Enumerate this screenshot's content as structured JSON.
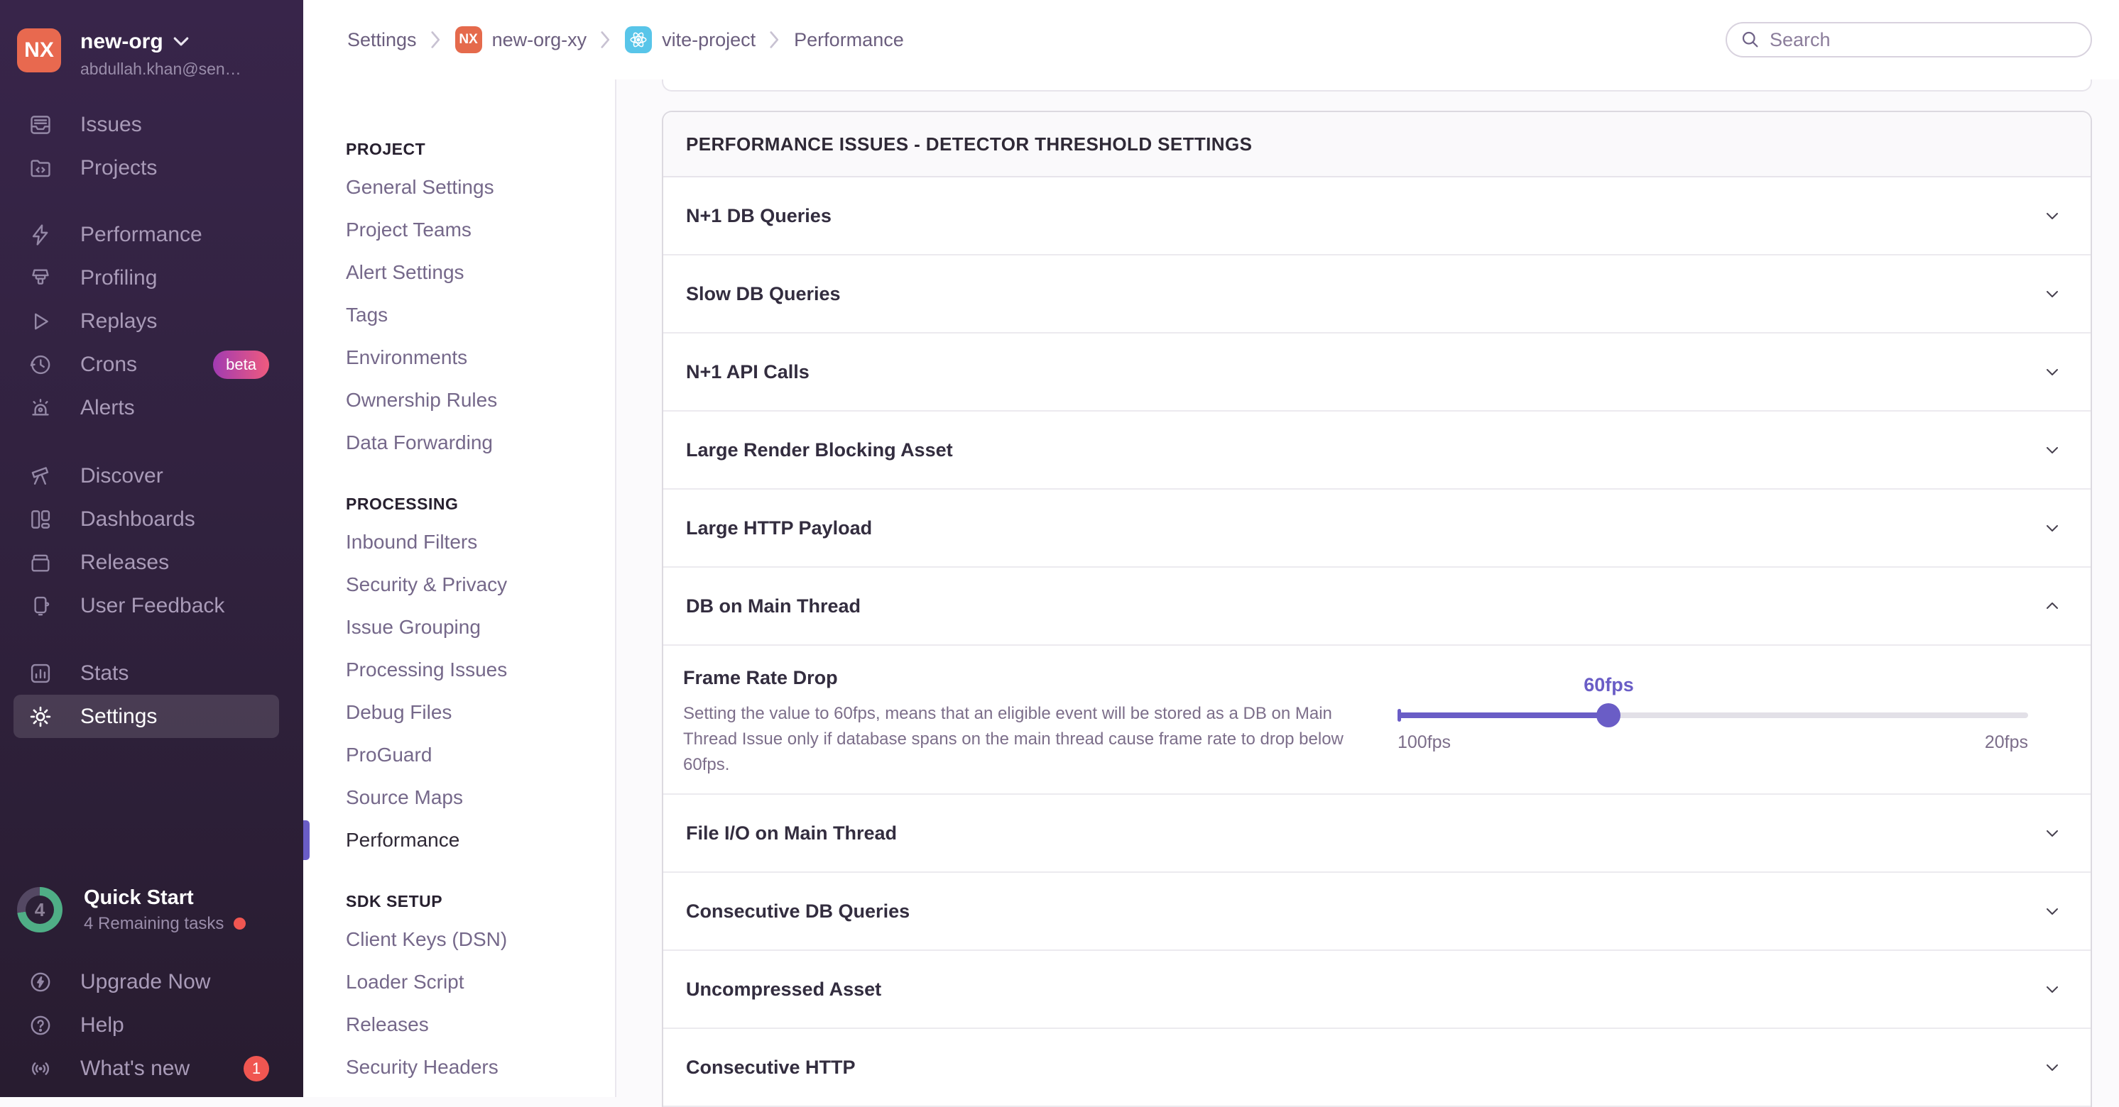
{
  "colors": {
    "accent_purple": "#6a5dc6",
    "org_orange": "#e8694f",
    "react_blue": "#58c5e9",
    "beta_gradient_from": "#a13bb2",
    "beta_gradient_to": "#ef5a7e",
    "progress_green": "#4fae86",
    "alert_red": "#f05651",
    "sidebar_top": "#38254a",
    "sidebar_bottom": "#281c30"
  },
  "org": {
    "initials": "NX",
    "name": "new-org",
    "email": "abdullah.khan@sen…"
  },
  "sidebar": {
    "groups": [
      {
        "items": [
          {
            "label": "Issues"
          },
          {
            "label": "Projects"
          }
        ]
      },
      {
        "items": [
          {
            "label": "Performance"
          },
          {
            "label": "Profiling"
          },
          {
            "label": "Replays"
          },
          {
            "label": "Crons",
            "badge": "beta"
          },
          {
            "label": "Alerts"
          }
        ]
      },
      {
        "items": [
          {
            "label": "Discover"
          },
          {
            "label": "Dashboards"
          },
          {
            "label": "Releases"
          },
          {
            "label": "User Feedback"
          }
        ]
      },
      {
        "items": [
          {
            "label": "Stats"
          },
          {
            "label": "Settings",
            "active": true
          }
        ]
      }
    ],
    "quick_start": {
      "label": "Quick Start",
      "sub": "4 Remaining tasks",
      "count": "4"
    },
    "footer": [
      {
        "label": "Upgrade Now"
      },
      {
        "label": "Help"
      },
      {
        "label": "What's new",
        "badge": "1"
      }
    ]
  },
  "breadcrumb": {
    "items": [
      "Settings",
      "new-org-xy",
      "vite-project",
      "Performance"
    ],
    "org_badge": "NX"
  },
  "search": {
    "placeholder": "Search"
  },
  "settings_nav": {
    "sections": [
      {
        "title": "PROJECT",
        "items": [
          "General Settings",
          "Project Teams",
          "Alert Settings",
          "Tags",
          "Environments",
          "Ownership Rules",
          "Data Forwarding"
        ]
      },
      {
        "title": "PROCESSING",
        "items": [
          "Inbound Filters",
          "Security & Privacy",
          "Issue Grouping",
          "Processing Issues",
          "Debug Files",
          "ProGuard",
          "Source Maps",
          "Performance"
        ],
        "active_item": "Performance"
      },
      {
        "title": "SDK SETUP",
        "items": [
          "Client Keys (DSN)",
          "Loader Script",
          "Releases",
          "Security Headers"
        ]
      }
    ]
  },
  "main": {
    "panel_title": "PERFORMANCE ISSUES - DETECTOR THRESHOLD SETTINGS",
    "rows_before": [
      "N+1 DB Queries",
      "Slow DB Queries",
      "N+1 API Calls",
      "Large Render Blocking Asset",
      "Large HTTP Payload"
    ],
    "expanded_row": {
      "label": "DB on Main Thread"
    },
    "detail": {
      "title": "Frame Rate Drop",
      "description": "Setting the value to 60fps, means that an eligible event will be stored as a DB on Main Thread Issue only if database spans on the main thread cause frame rate to drop below 60fps.",
      "slider": {
        "value_label": "60fps",
        "min_label": "100fps",
        "max_label": "20fps",
        "percent": 33.5
      }
    },
    "rows_after": [
      "File I/O on Main Thread",
      "Consecutive DB Queries",
      "Uncompressed Asset",
      "Consecutive HTTP"
    ]
  }
}
